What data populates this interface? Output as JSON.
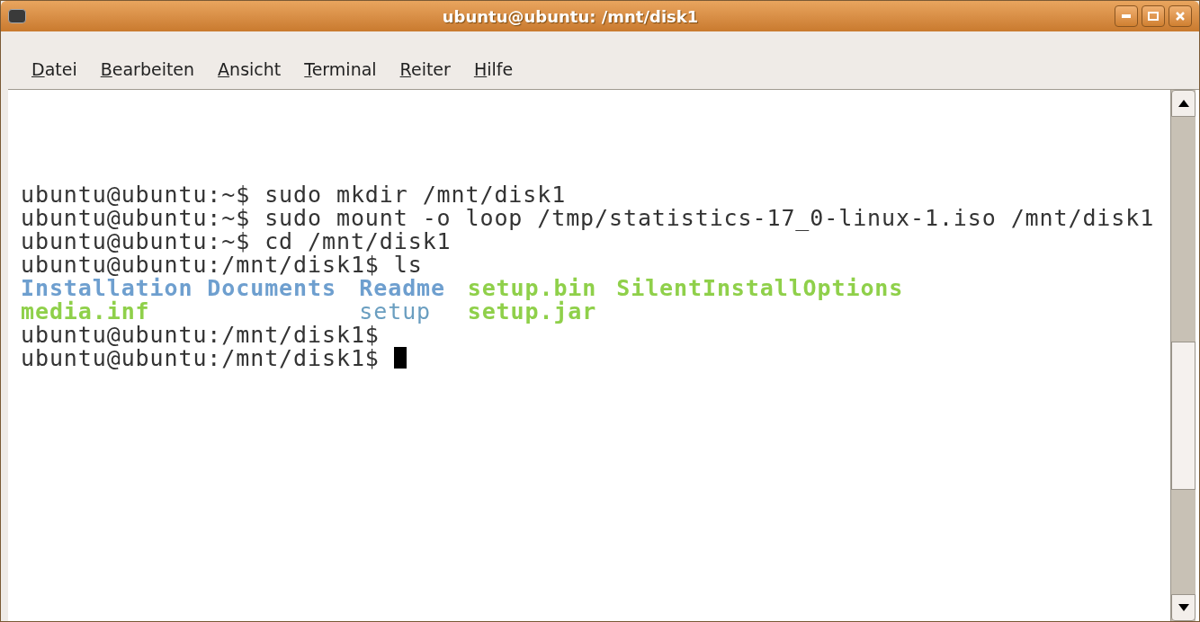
{
  "window": {
    "title": "ubuntu@ubuntu: /mnt/disk1"
  },
  "menu": [
    {
      "label": "Datei",
      "mnemonic_underlined": true
    },
    {
      "label": "Bearbeiten",
      "mnemonic_underlined": true
    },
    {
      "label": "Ansicht",
      "mnemonic_underlined": true
    },
    {
      "label": "Terminal",
      "mnemonic_underlined": true
    },
    {
      "label": "Reiter",
      "mnemonic_underlined": true
    },
    {
      "label": "Hilfe",
      "mnemonic_underlined": true
    }
  ],
  "terminal": {
    "lines": [
      {
        "kind": "text",
        "text": "ubuntu@ubuntu:~$ sudo mkdir /mnt/disk1"
      },
      {
        "kind": "text",
        "text": "ubuntu@ubuntu:~$ sudo mount -o loop /tmp/statistics-17_0-linux-1.iso /mnt/disk1"
      },
      {
        "kind": "text",
        "text": "ubuntu@ubuntu:~$ cd /mnt/disk1"
      },
      {
        "kind": "text",
        "text": "ubuntu@ubuntu:/mnt/disk1$ ls"
      },
      {
        "kind": "listing",
        "entries": [
          {
            "name": "Installation Documents",
            "kind": "directory"
          },
          {
            "name": "Readme",
            "kind": "directory"
          },
          {
            "name": "setup.bin",
            "kind": "executable"
          },
          {
            "name": "SilentInstallOptions",
            "kind": "executable"
          }
        ]
      },
      {
        "kind": "listing",
        "entries": [
          {
            "name": "media.inf",
            "kind": "executable"
          },
          {
            "name": "setup",
            "kind": "link"
          },
          {
            "name": "setup.jar",
            "kind": "executable"
          }
        ]
      },
      {
        "kind": "text",
        "text": "ubuntu@ubuntu:/mnt/disk1$"
      },
      {
        "kind": "text",
        "text": "ubuntu@ubuntu:/mnt/disk1$ ",
        "cursor": true
      }
    ]
  }
}
